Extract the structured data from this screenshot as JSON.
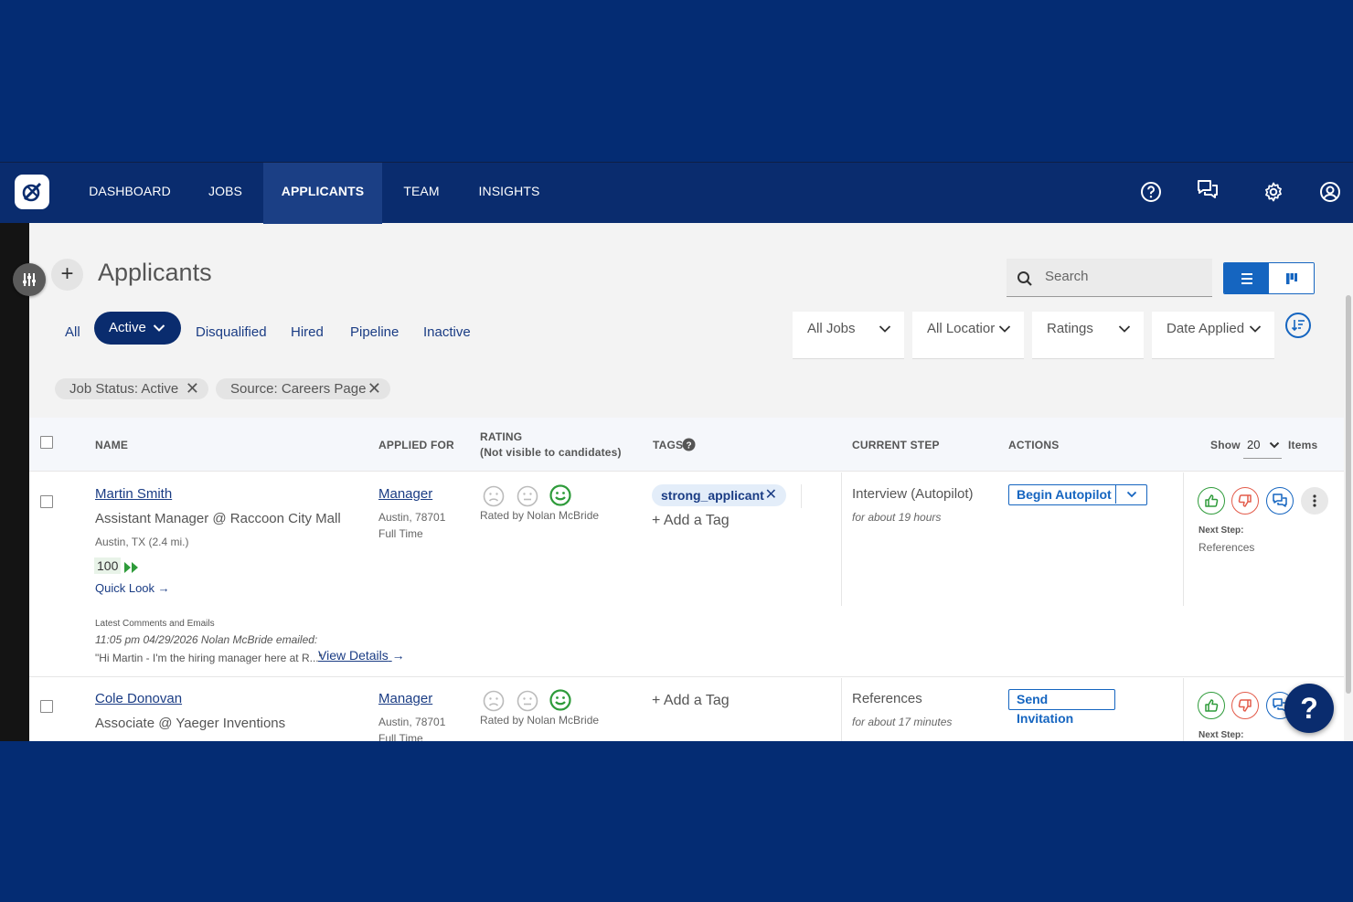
{
  "nav": {
    "items": [
      {
        "label": "DASHBOARD"
      },
      {
        "label": "JOBS"
      },
      {
        "label": "APPLICANTS"
      },
      {
        "label": "TEAM"
      },
      {
        "label": "INSIGHTS"
      }
    ],
    "active": "APPLICANTS",
    "icons": [
      "help-circle-icon",
      "chat-icon",
      "gear-icon",
      "user-account-icon"
    ]
  },
  "page": {
    "title": "Applicants",
    "search_placeholder": "Search"
  },
  "tabs": {
    "all": "All",
    "active": "Active",
    "disqualified": "Disqualified",
    "hired": "Hired",
    "pipeline": "Pipeline",
    "inactive": "Inactive"
  },
  "filters": {
    "jobs": "All Jobs",
    "locations": "All Locatior",
    "ratings": "Ratings",
    "date": "Date Applied"
  },
  "chips": {
    "job_status": "Job Status: Active",
    "source": "Source: Careers Page"
  },
  "table": {
    "headers": {
      "name": "NAME",
      "applied_for": "APPLIED FOR",
      "rating": "RATING",
      "rating_note": "(Not visible to candidates)",
      "tags": "TAGS",
      "current_step": "CURRENT STEP",
      "actions": "ACTIONS",
      "show": "Show",
      "show_value": "20",
      "items": "Items"
    },
    "rows": [
      {
        "name": "Martin Smith",
        "title": "Assistant Manager @ Raccoon City Mall",
        "location": "Austin, TX (2.4 mi.)",
        "score": "100",
        "quick_look": "Quick Look →",
        "job": "Manager",
        "job_location": "Austin, 78701",
        "job_type": "Full Time",
        "rated_by": "Rated by Nolan McBride",
        "tag": "strong_applicant",
        "add_tag": "+ Add a Tag",
        "step": "Interview (Autopilot)",
        "step_time": "for about 19 hours",
        "action": "Begin Autopilot",
        "next_step_label": "Next Step:",
        "next_step": "References",
        "comments_title": "Latest Comments and Emails",
        "comment_meta": "11:05 pm 04/29/2026 Nolan McBride emailed:",
        "comment_text": "\"Hi Martin - I'm the hiring manager here at R...\"",
        "view_details": "View Details"
      },
      {
        "name": "Cole Donovan",
        "title": "Associate @ Yaeger Inventions",
        "job": "Manager",
        "job_location": "Austin, 78701",
        "job_type": "Full Time",
        "rated_by": "Rated by Nolan McBride",
        "add_tag": "+ Add a Tag",
        "step": "References",
        "step_time": "for about 17 minutes",
        "action": "Send Invitation",
        "next_step_label": "Next Step:"
      }
    ]
  },
  "help": "?",
  "colors": {
    "nav_bg": "#0a2c6e",
    "accent": "#1565c0",
    "positive": "#2e9b3a",
    "negative": "#e35b4a"
  }
}
